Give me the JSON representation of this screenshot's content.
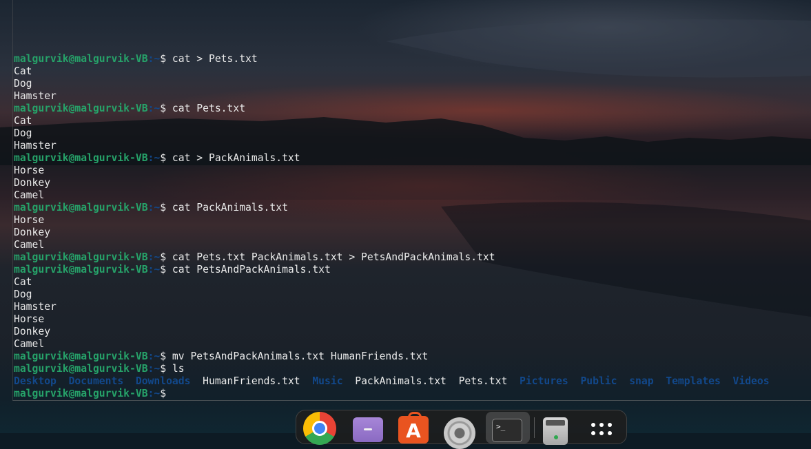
{
  "terminal": {
    "user_host": "malgurvik@malgurvik-VB",
    "cwd": ":~",
    "prompt_symbol": "$ ",
    "lines": [
      {
        "type": "prompt",
        "cmd": "cat > Pets.txt"
      },
      {
        "type": "out",
        "text": "Cat"
      },
      {
        "type": "out",
        "text": "Dog"
      },
      {
        "type": "out",
        "text": "Hamster"
      },
      {
        "type": "prompt",
        "cmd": "cat Pets.txt"
      },
      {
        "type": "out",
        "text": "Cat"
      },
      {
        "type": "out",
        "text": "Dog"
      },
      {
        "type": "out",
        "text": "Hamster"
      },
      {
        "type": "prompt",
        "cmd": "cat > PackAnimals.txt"
      },
      {
        "type": "out",
        "text": "Horse"
      },
      {
        "type": "out",
        "text": "Donkey"
      },
      {
        "type": "out",
        "text": "Camel"
      },
      {
        "type": "prompt",
        "cmd": "cat PackAnimals.txt"
      },
      {
        "type": "out",
        "text": "Horse"
      },
      {
        "type": "out",
        "text": "Donkey"
      },
      {
        "type": "out",
        "text": "Camel"
      },
      {
        "type": "prompt",
        "cmd": "cat Pets.txt PackAnimals.txt > PetsAndPackAnimals.txt"
      },
      {
        "type": "prompt",
        "cmd": "cat PetsAndPackAnimals.txt"
      },
      {
        "type": "out",
        "text": "Cat"
      },
      {
        "type": "out",
        "text": "Dog"
      },
      {
        "type": "out",
        "text": "Hamster"
      },
      {
        "type": "out",
        "text": "Horse"
      },
      {
        "type": "out",
        "text": "Donkey"
      },
      {
        "type": "out",
        "text": "Camel"
      },
      {
        "type": "prompt",
        "cmd": "mv PetsAndPackAnimals.txt HumanFriends.txt"
      },
      {
        "type": "prompt",
        "cmd": "ls"
      }
    ],
    "ls_entries": [
      {
        "name": "Desktop",
        "kind": "dir"
      },
      {
        "name": "Documents",
        "kind": "dir"
      },
      {
        "name": "Downloads",
        "kind": "dir"
      },
      {
        "name": "HumanFriends.txt",
        "kind": "file"
      },
      {
        "name": "Music",
        "kind": "dir"
      },
      {
        "name": "PackAnimals.txt",
        "kind": "file"
      },
      {
        "name": "Pets.txt",
        "kind": "file"
      },
      {
        "name": "Pictures",
        "kind": "dir"
      },
      {
        "name": "Public",
        "kind": "dir"
      },
      {
        "name": "snap",
        "kind": "dir"
      },
      {
        "name": "Templates",
        "kind": "dir"
      },
      {
        "name": "Videos",
        "kind": "dir"
      }
    ],
    "final_prompt_cmd": ""
  },
  "dock": {
    "items": [
      {
        "name": "chrome",
        "icon": "chrome-icon"
      },
      {
        "name": "files",
        "icon": "folder-icon"
      },
      {
        "name": "app-center",
        "icon": "app-store-icon",
        "glyph": "A"
      },
      {
        "name": "settings",
        "icon": "gear-icon"
      },
      {
        "name": "terminal",
        "icon": "terminal-icon",
        "glyph": ">_"
      },
      {
        "name": "usb-drive",
        "icon": "usb-drive-icon"
      },
      {
        "name": "show-apps",
        "icon": "app-grid-icon"
      }
    ]
  },
  "colors": {
    "user_host": "#26a269",
    "path": "#12488b",
    "text": "#eaeaea"
  }
}
